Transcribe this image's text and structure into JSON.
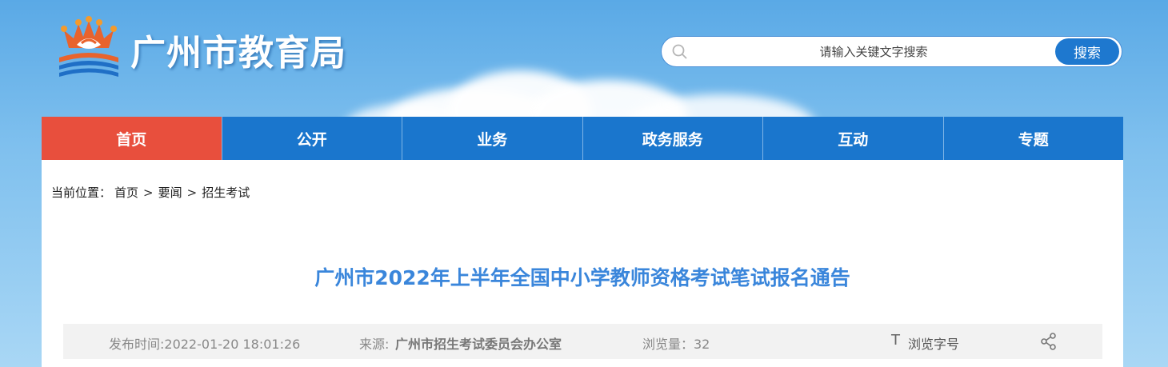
{
  "header": {
    "site_title": "广州市教育局",
    "search": {
      "placeholder": "请输入关键文字搜索",
      "button_label": "搜索"
    }
  },
  "nav": {
    "items": [
      {
        "label": "首页",
        "active": true
      },
      {
        "label": "公开"
      },
      {
        "label": "业务"
      },
      {
        "label": "政务服务"
      },
      {
        "label": "互动"
      },
      {
        "label": "专题"
      }
    ]
  },
  "breadcrumb": {
    "prefix": "当前位置：",
    "items": [
      "首页",
      "要闻",
      "招生考试"
    ],
    "separator": ">"
  },
  "article": {
    "title": "广州市2022年上半年全国中小学教师资格考试笔试报名通告",
    "meta": {
      "publish_time": "发布时间:2022-01-20 18:01:26",
      "source_label": "来源:",
      "source_value": "广州市招生考试委员会办公室",
      "views": "浏览量：32",
      "font_icon": "T",
      "font_size_label": "浏览字号"
    }
  },
  "colors": {
    "nav_bg": "#1a76cd",
    "nav_active": "#e84f3d",
    "title_blue": "#3a86db",
    "search_button": "#1e78cf"
  }
}
